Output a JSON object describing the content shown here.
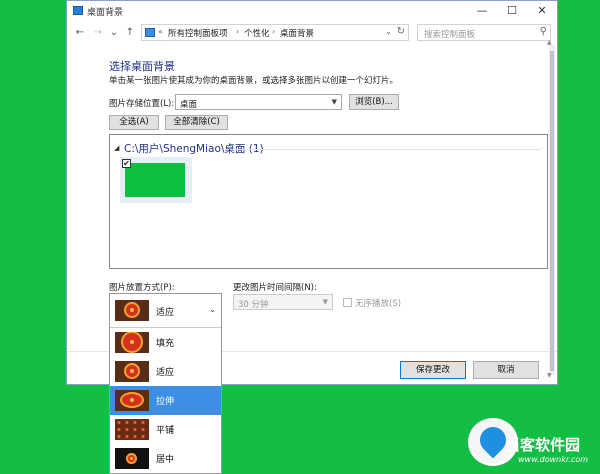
{
  "window": {
    "title": "桌面背景",
    "controls": {
      "minimize": "—",
      "maximize": "☐",
      "close": "✕"
    }
  },
  "address_bar": {
    "back": "←",
    "forward": "→",
    "recent": "⌄",
    "up": "↑",
    "overflow": "«",
    "crumbs": [
      "所有控制面板项",
      "个性化",
      "桌面背景"
    ],
    "separator": "›",
    "dropdown": "⌄",
    "refresh": "↻"
  },
  "search": {
    "placeholder": "搜索控制面板",
    "icon": "search-icon"
  },
  "content": {
    "heading": "选择桌面背景",
    "description": "单击某一张图片使其成为你的桌面背景，或选择多张图片以创建一个幻灯片。",
    "location_label": "图片存储位置(L):",
    "location_value": "桌面",
    "browse_button": "浏览(B)...",
    "select_all_button": "全选(A)",
    "clear_all_button": "全部清除(C)"
  },
  "picture_list": {
    "group_title": "C:\\用户\\ShengMiao\\桌面 (1)",
    "items": [
      {
        "checked": true,
        "color": "#0fbf3e"
      }
    ]
  },
  "position": {
    "label": "图片放置方式(P):",
    "selected": "适应",
    "options": [
      "填充",
      "适应",
      "拉伸",
      "平铺",
      "居中"
    ],
    "highlighted": "拉伸"
  },
  "interval": {
    "label": "更改图片时间间隔(N):",
    "value": "30 分钟",
    "shuffle_label": "无序播放(S)",
    "shuffle_checked": false
  },
  "footer": {
    "save_button": "保存更改",
    "cancel_button": "取消"
  },
  "watermark": {
    "name": "当客软件园",
    "url": "www.downkr.com"
  },
  "colors": {
    "desktop": "#14bd43",
    "accent": "#3f8ee6",
    "heading": "#1e3287"
  }
}
